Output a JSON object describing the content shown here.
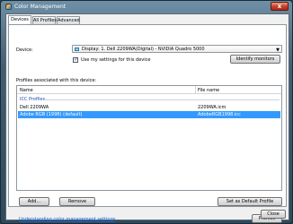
{
  "window": {
    "title": "Color Management",
    "close_glyph": "x"
  },
  "tabs": [
    {
      "label": "Devices"
    },
    {
      "label": "All Profiles"
    },
    {
      "label": "Advanced"
    }
  ],
  "device": {
    "label": "Device:",
    "selected": "Display: 1. Dell 2209WA(Digital) - NVIDIA Quadro 5000",
    "use_settings_label": "Use my settings for this device",
    "use_settings_checked": true,
    "identify_button": "Identify monitors"
  },
  "profiles": {
    "heading": "Profiles associated with this device:",
    "columns": {
      "name": "Name",
      "file": "File name"
    },
    "group": "ICC Profiles",
    "rows": [
      {
        "name": "Dell 2209WA",
        "file": "2209WA.icm"
      },
      {
        "name": "Adobe RGB (1998) (default)",
        "file": "AdobeRGB1998.icc"
      }
    ],
    "add_button": "Add...",
    "remove_button": "Remove",
    "default_button": "Set as Default Profile"
  },
  "footer": {
    "link": "Understanding color management settings",
    "profiles_button": "Profiles",
    "close_button": "Close"
  }
}
